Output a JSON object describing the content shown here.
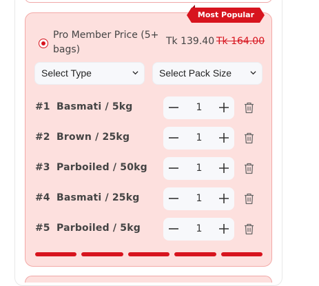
{
  "offer": {
    "badge": "Most Popular",
    "option_label": "Pro Member Price (5+ bags)",
    "price_current": "Tk 139.40",
    "price_original": "Tk 164.00",
    "selected": true
  },
  "selects": {
    "type_label": "Select Type",
    "pack_size_label": "Select Pack Size"
  },
  "items": [
    {
      "number": "#1",
      "name": "Basmati / 5kg",
      "qty": "1"
    },
    {
      "number": "#2",
      "name": "Brown / 25kg",
      "qty": "1"
    },
    {
      "number": "#3",
      "name": "Parboiled / 50kg",
      "qty": "1"
    },
    {
      "number": "#4",
      "name": "Basmati / 25kg",
      "qty": "1"
    },
    {
      "number": "#5",
      "name": "Parboiled / 5kg",
      "qty": "1"
    }
  ],
  "progress": {
    "filled_segments": 5,
    "total_segments": 5
  },
  "colors": {
    "accent": "#d7141e",
    "card_bg": "#fde0de",
    "card_border": "#f3a9a6"
  },
  "icons": {
    "minus": "minus-icon",
    "plus": "plus-icon",
    "delete": "trash-icon",
    "dropdown": "chevron-down-icon"
  }
}
